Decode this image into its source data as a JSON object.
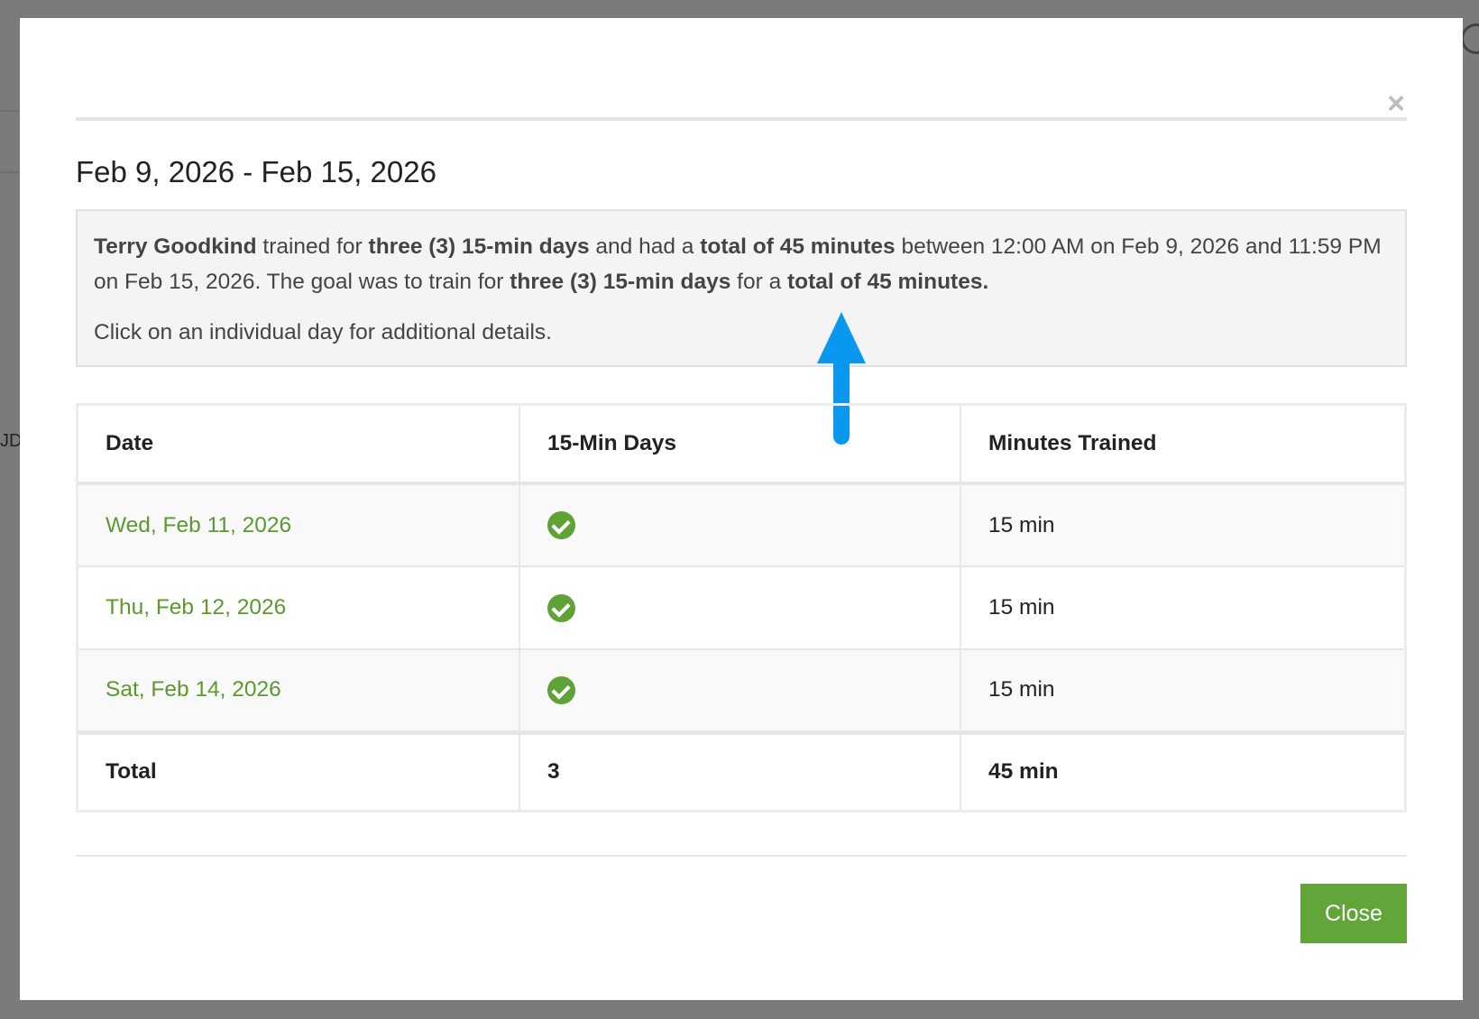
{
  "background": {
    "partial_text": "JD"
  },
  "modal": {
    "close_icon": "×",
    "title": "Feb 9, 2026 - Feb 15, 2026",
    "summary": {
      "name": "Terry Goodkind",
      "t1": " trained for ",
      "b1": "three (3) 15-min days",
      "t2": " and had a ",
      "b2": "total of 45 minutes",
      "t3": " between 12:00 AM on Feb 9, 2026 and 11:59 PM on Feb 15, 2026. The goal was to train for ",
      "b3": "three (3) 15-min days",
      "t4": " for a ",
      "b4": "total of 45 minutes.",
      "hint": "Click on an individual day for additional details."
    },
    "table": {
      "headers": [
        "Date",
        "15-Min Days",
        "Minutes Trained"
      ],
      "rows": [
        {
          "date": "Wed, Feb 11, 2026",
          "completed": true,
          "minutes": "15 min"
        },
        {
          "date": "Thu, Feb 12, 2026",
          "completed": true,
          "minutes": "15 min"
        },
        {
          "date": "Sat, Feb 14, 2026",
          "completed": true,
          "minutes": "15 min"
        }
      ],
      "total": {
        "label": "Total",
        "days": "3",
        "minutes": "45 min"
      }
    },
    "close_button": "Close"
  },
  "colors": {
    "accent_green": "#62a639",
    "link_green": "#5a9a2d",
    "arrow_blue": "#0a97f0"
  },
  "icons": [
    "close-icon",
    "check-circle-icon",
    "arrow-up-icon"
  ]
}
